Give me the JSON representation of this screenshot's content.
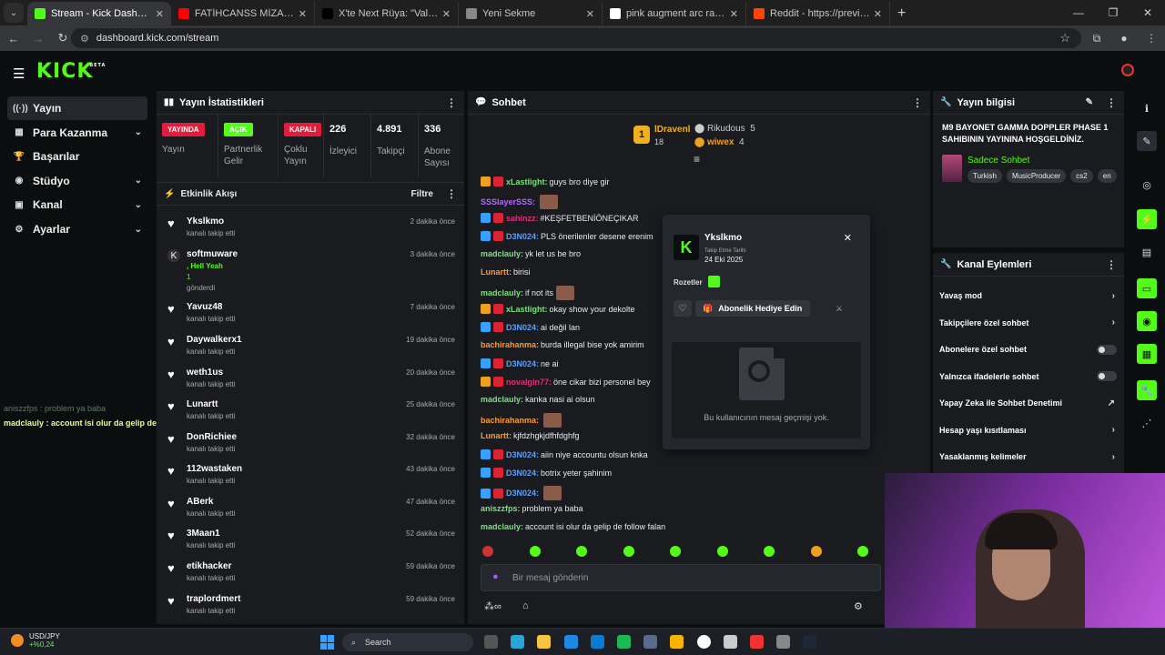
{
  "browser": {
    "tabs": [
      {
        "title": "Stream - Kick Dashboard",
        "color": "#53fc18",
        "active": true
      },
      {
        "title": "FATİHCANSS MİZAH - JETT AN...",
        "color": "#ff0000",
        "active": false
      },
      {
        "title": "X'te Next Rüya: \"Valorant takım...",
        "color": "#000000",
        "active": false
      },
      {
        "title": "Yeni Sekme",
        "color": "#888888",
        "active": false
      },
      {
        "title": "pink augment arc raiders - Goo...",
        "color": "#ffffff",
        "active": false
      },
      {
        "title": "Reddit - https://preview.redd.it...",
        "color": "#ff4500",
        "active": false
      }
    ],
    "url": "dashboard.kick.com/stream"
  },
  "nav": {
    "items": [
      {
        "label": "Yayın",
        "icon": "broadcast-icon",
        "chev": ""
      },
      {
        "label": "Para Kazanma",
        "icon": "money-icon",
        "chev": "⌄"
      },
      {
        "label": "Başarılar",
        "icon": "trophy-icon",
        "chev": ""
      },
      {
        "label": "Stüdyo",
        "icon": "studio-icon",
        "chev": "⌄"
      },
      {
        "label": "Kanal",
        "icon": "channel-icon",
        "chev": "⌄"
      },
      {
        "label": "Ayarlar",
        "icon": "gear-icon",
        "chev": "⌄"
      }
    ]
  },
  "overlay": {
    "line1": "aniszzfps : problem ya baba",
    "line2": "madclauly : account isi olur da gelip de follow falan"
  },
  "stats": {
    "title": "Yayın İstatistikleri",
    "items": [
      {
        "pill": "YAYINDA",
        "pill_color": "#e31b3c",
        "label": "Yayın"
      },
      {
        "pill": "AÇIK",
        "pill_color": "#53fc18",
        "label": "Partnerlik Gelir Programı"
      },
      {
        "pill": "KAPALI",
        "pill_color": "#e31b3c",
        "label": "Çoklu Yayın"
      },
      {
        "num": "226",
        "label": "İzleyici"
      },
      {
        "num": "4.891",
        "label": "Takipçi"
      },
      {
        "num": "336",
        "label": "Abone Sayısı"
      }
    ]
  },
  "activity": {
    "title": "Etkinlik Akışı",
    "filter": "Filtre",
    "items": [
      {
        "name": "Ykslkmo",
        "sub": "kanalı takip etti",
        "time": "2 dakika önce",
        "icon": "♥"
      },
      {
        "name": "softmuware",
        "sub": ", Hell Yeah",
        "sub2": "1",
        "sub3": "gönderdi",
        "time": "3 dakika önce",
        "icon": "K"
      },
      {
        "name": "Yavuz48",
        "sub": "kanalı takip etti",
        "time": "7 dakika önce",
        "icon": "♥"
      },
      {
        "name": "Daywalkerx1",
        "sub": "kanalı takip etti",
        "time": "19 dakika önce",
        "icon": "♥"
      },
      {
        "name": "weth1us",
        "sub": "kanalı takip etti",
        "time": "20 dakika önce",
        "icon": "♥"
      },
      {
        "name": "Lunartt",
        "sub": "kanalı takip etti",
        "time": "25 dakika önce",
        "icon": "♥"
      },
      {
        "name": "DonRichiee",
        "sub": "kanalı takip etti",
        "time": "32 dakika önce",
        "icon": "♥"
      },
      {
        "name": "112wastaken",
        "sub": "kanalı takip etti",
        "time": "43 dakika önce",
        "icon": "♥"
      },
      {
        "name": "ABerk",
        "sub": "kanalı takip etti",
        "time": "47 dakika önce",
        "icon": "♥"
      },
      {
        "name": "3Maan1",
        "sub": "kanalı takip etti",
        "time": "52 dakika önce",
        "icon": "♥"
      },
      {
        "name": "etikhacker",
        "sub": "kanalı takip etti",
        "time": "59 dakika önce",
        "icon": "♥"
      },
      {
        "name": "traplordmert",
        "sub": "kanalı takip etti",
        "time": "59 dakika önce",
        "icon": "♥"
      }
    ]
  },
  "chat": {
    "title": "Sohbet",
    "leaders": [
      {
        "rank": "1",
        "name": "lDravenl",
        "count": "18"
      },
      {
        "name": "Rikudous",
        "count": "5"
      },
      {
        "name": "wiwex",
        "count": "4"
      }
    ],
    "messages": [
      {
        "user": "xLastlight:",
        "color": "#7ee07e",
        "text": "guys bro diye gir",
        "badge": "#f0a020"
      },
      {
        "user": "SSSlayerSSS:",
        "color": "#b36bff",
        "text": "",
        "badge": ""
      },
      {
        "user": "sahinzz:",
        "color": "#e0307a",
        "text": "#KEŞFETBENİÖNEÇIKAR",
        "badge": "#3aa0ff"
      },
      {
        "user": "D3N024:",
        "color": "#5aa0ff",
        "text": "PLS önerilenler desene erenim",
        "badge": "#3aa0ff"
      },
      {
        "user": "madclauly:",
        "color": "#7ee07e",
        "text": "yk let us be bro",
        "badge": ""
      },
      {
        "user": "Lunartt:",
        "color": "#ff9a2e",
        "text": "birisi",
        "badge": ""
      },
      {
        "user": "madclauly:",
        "color": "#7ee07e",
        "text": "if not its",
        "badge": ""
      },
      {
        "user": "xLastlight:",
        "color": "#7ee07e",
        "text": "okay show your dekolte",
        "badge": "#f0a020"
      },
      {
        "user": "D3N024:",
        "color": "#5aa0ff",
        "text": "ai değil lan",
        "badge": "#3aa0ff"
      },
      {
        "user": "bachirahanma:",
        "color": "#ff9a2e",
        "text": "burda illegal bise yok amirim",
        "badge": ""
      },
      {
        "user": "D3N024:",
        "color": "#5aa0ff",
        "text": "ne ai",
        "badge": "#3aa0ff"
      },
      {
        "user": "novalgin77:",
        "color": "#e0307a",
        "text": "öne cikar bizi personel bey",
        "badge": "#f0a020"
      },
      {
        "user": "madclauly:",
        "color": "#7ee07e",
        "text": "kanka nasi ai olsun",
        "badge": ""
      },
      {
        "user": "bachirahanma:",
        "color": "#ff9a2e",
        "text": "",
        "badge": ""
      },
      {
        "user": "Lunartt:",
        "color": "#ff9a2e",
        "text": "kjfdzhgkjdfhfdghfg",
        "badge": ""
      },
      {
        "user": "D3N024:",
        "color": "#5aa0ff",
        "text": "aiin niye accountu olsun knka",
        "badge": "#3aa0ff"
      },
      {
        "user": "D3N024:",
        "color": "#5aa0ff",
        "text": "botrix yeter şahinim",
        "badge": "#3aa0ff"
      },
      {
        "user": "D3N024:",
        "color": "#5aa0ff",
        "text": "",
        "badge": "#3aa0ff"
      },
      {
        "user": "aniszzfps:",
        "color": "#7ee07e",
        "text": "problem ya baba",
        "badge": ""
      },
      {
        "user": "madclauly:",
        "color": "#7ee07e",
        "text": "account isi olur da gelip de follow falan",
        "badge": ""
      }
    ],
    "input_placeholder": "Bir mesaj gönderin"
  },
  "usercard": {
    "name": "Ykslkmo",
    "since_label": "Takip Etme Tarihi",
    "since": "24 Eki 2025",
    "badges_label": "Rozetler",
    "gift_label": "Abonelik Hediye Edin",
    "history_text": "Bu kullanıcının mesaj geçmişi yok."
  },
  "info": {
    "title": "Yayın bilgisi",
    "stream_title": "M9 BAYONET GAMMA DOPPLER PHASE 1 SAHIBININ YAYININA HOŞGELDİNİZ.",
    "category": "Sadece Sohbet",
    "tags": [
      "Turkish",
      "MusicProducer",
      "cs2",
      "en"
    ]
  },
  "actions": {
    "title": "Kanal Eylemleri",
    "items": [
      {
        "label": "Yavaş mod",
        "kind": "chev"
      },
      {
        "label": "Takipçilere özel sohbet",
        "kind": "chev"
      },
      {
        "label": "Abonelere özel sohbet",
        "kind": "toggle"
      },
      {
        "label": "Yalnızca ifadelerle sohbet",
        "kind": "toggle"
      },
      {
        "label": "Yapay Zeka ile Sohbet Denetimi",
        "kind": "ext"
      },
      {
        "label": "Hesap yaşı kısıtlaması",
        "kind": "chev"
      },
      {
        "label": "Yasaklanmış kelimeler",
        "kind": "chev"
      }
    ]
  },
  "taskbar": {
    "ticker_symbol": "USD/JPY",
    "ticker_change": "+%0,24",
    "search": "Search"
  }
}
